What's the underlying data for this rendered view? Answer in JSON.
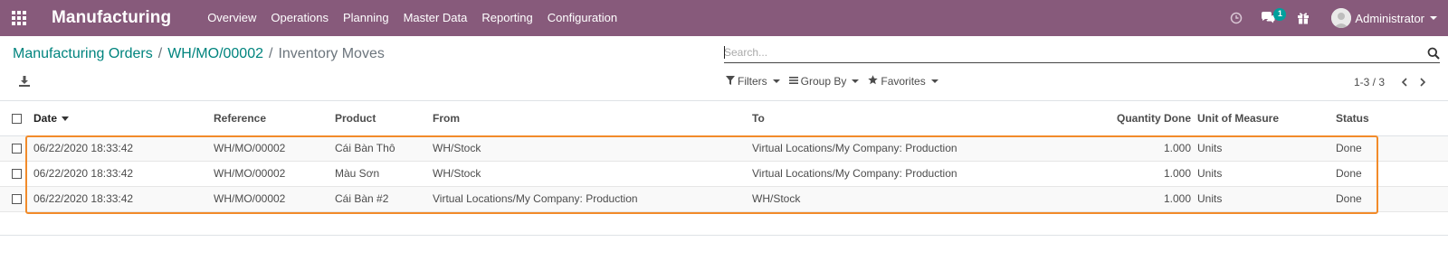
{
  "navbar": {
    "brand": "Manufacturing",
    "menu": [
      "Overview",
      "Operations",
      "Planning",
      "Master Data",
      "Reporting",
      "Configuration"
    ],
    "messages_count": "1",
    "user_name": "Administrator",
    "color": "#875a7b"
  },
  "breadcrumb": {
    "items": [
      "Manufacturing Orders",
      "WH/MO/00002"
    ],
    "separator": "/",
    "current": "Inventory Moves"
  },
  "search": {
    "placeholder": "Search..."
  },
  "filters": {
    "filters_label": "Filters",
    "groupby_label": "Group By",
    "favorites_label": "Favorites"
  },
  "pager": {
    "value": "1-3 / 3"
  },
  "table": {
    "columns": [
      "Date",
      "Reference",
      "Product",
      "From",
      "To",
      "Quantity Done",
      "Unit of Measure",
      "Status"
    ],
    "rows": [
      [
        "06/22/2020 18:33:42",
        "WH/MO/00002",
        "Cái Bàn Thô",
        "WH/Stock",
        "Virtual Locations/My Company: Production",
        "1.000",
        "Units",
        "Done"
      ],
      [
        "06/22/2020 18:33:42",
        "WH/MO/00002",
        "Màu Sơn",
        "WH/Stock",
        "Virtual Locations/My Company: Production",
        "1.000",
        "Units",
        "Done"
      ],
      [
        "06/22/2020 18:33:42",
        "WH/MO/00002",
        "Cái Bàn #2",
        "Virtual Locations/My Company: Production",
        "WH/Stock",
        "1.000",
        "Units",
        "Done"
      ]
    ]
  },
  "colors": {
    "link": "#00847e",
    "highlight": "#f28b2a",
    "badge": "#00a09d"
  }
}
